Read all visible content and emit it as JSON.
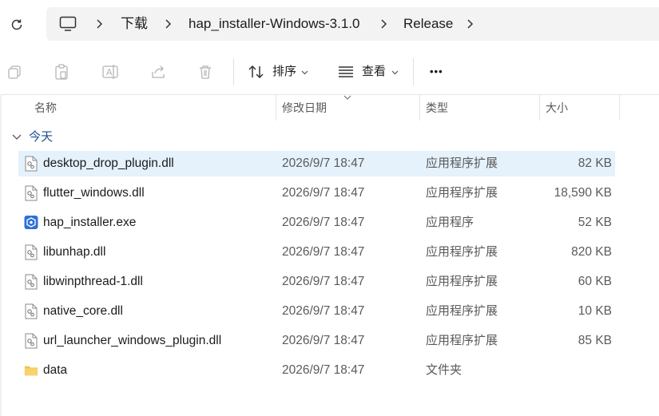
{
  "breadcrumb": {
    "items": [
      "下载",
      "hap_installer-Windows-3.1.0",
      "Release"
    ]
  },
  "toolbar": {
    "sort_label": "排序",
    "view_label": "查看",
    "more_label": "•••"
  },
  "columns": {
    "name": "名称",
    "date": "修改日期",
    "type": "类型",
    "size": "大小"
  },
  "group": {
    "label": "今天"
  },
  "files": [
    {
      "name": "desktop_drop_plugin.dll",
      "date": "2026/9/7 18:47",
      "type": "应用程序扩展",
      "size": "82 KB",
      "icon": "dll-file-icon"
    },
    {
      "name": "flutter_windows.dll",
      "date": "2026/9/7 18:47",
      "type": "应用程序扩展",
      "size": "18,590 KB",
      "icon": "dll-file-icon"
    },
    {
      "name": "hap_installer.exe",
      "date": "2026/9/7 18:47",
      "type": "应用程序",
      "size": "52 KB",
      "icon": "app-exe-icon"
    },
    {
      "name": "libunhap.dll",
      "date": "2026/9/7 18:47",
      "type": "应用程序扩展",
      "size": "820 KB",
      "icon": "dll-file-icon"
    },
    {
      "name": "libwinpthread-1.dll",
      "date": "2026/9/7 18:47",
      "type": "应用程序扩展",
      "size": "60 KB",
      "icon": "dll-file-icon"
    },
    {
      "name": "native_core.dll",
      "date": "2026/9/7 18:47",
      "type": "应用程序扩展",
      "size": "10 KB",
      "icon": "dll-file-icon"
    },
    {
      "name": "url_launcher_windows_plugin.dll",
      "date": "2026/9/7 18:47",
      "type": "应用程序扩展",
      "size": "85 KB",
      "icon": "dll-file-icon"
    },
    {
      "name": "data",
      "date": "2026/9/7 18:47",
      "type": "文件夹",
      "size": "",
      "icon": "folder-icon"
    }
  ],
  "colors": {
    "selected_row": "#e5f1fb",
    "group_label": "#1f4e8c",
    "exe_icon": "#2e6fd8",
    "folder": "#f2c24f"
  }
}
